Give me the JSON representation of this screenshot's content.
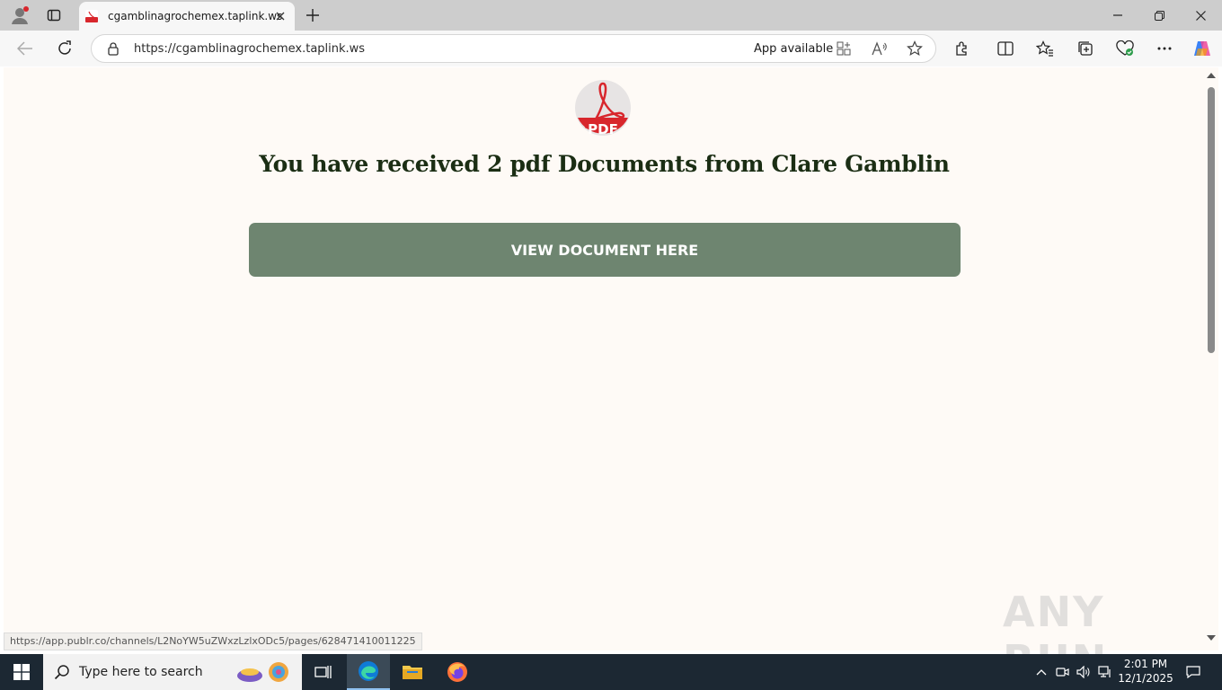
{
  "browser": {
    "tab": {
      "title": "cgamblinagrochemex.taplink.ws"
    },
    "address_bar": {
      "url": "https://cgamblinagrochemex.taplink.ws",
      "app_available": "App available"
    },
    "status_url": "https://app.publr.co/channels/L2NoYW5uZWxzLzlxODc5/pages/628471410011225"
  },
  "page": {
    "logo_text": "PDF",
    "headline": "You have received 2 pdf Documents from Clare Gamblin",
    "cta_label": "VIEW DOCUMENT HERE",
    "background_color": "#fefaf6",
    "button_color": "#6e8570",
    "headline_color": "#1b2e14"
  },
  "watermark": "ANY RUN",
  "taskbar": {
    "search_placeholder": "Type here to search",
    "time": "2:01 PM",
    "date": "12/1/2025"
  }
}
